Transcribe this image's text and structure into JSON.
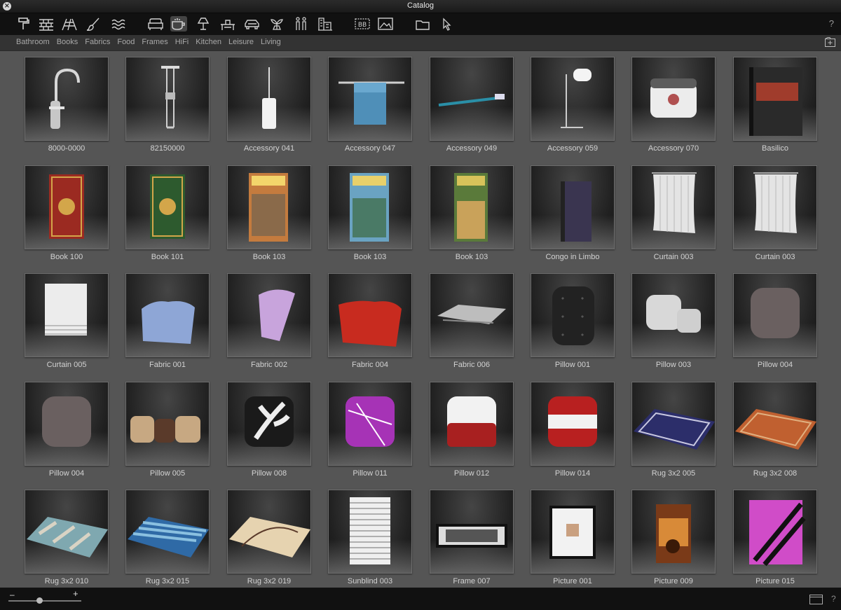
{
  "window": {
    "title": "Catalog",
    "close_glyph": "×"
  },
  "toolbar": {
    "icons": [
      "paint-roller-icon",
      "brick-wall-icon",
      "stairs-icon",
      "brush-icon",
      "water-waves-icon",
      "sofa-icon",
      "cup-icon",
      "lamp-icon",
      "desk-icon",
      "car-icon",
      "plant-icon",
      "people-icon",
      "building-icon",
      "billboard-icon",
      "picture-icon",
      "folder-icon",
      "cursor-icon"
    ],
    "active": "cup-icon",
    "help": "?"
  },
  "categories": [
    "Bathroom",
    "Books",
    "Fabrics",
    "Food",
    "Frames",
    "HiFi",
    "Kitchen",
    "Leisure",
    "Living"
  ],
  "items": [
    {
      "label": "8000-0000",
      "obj": "faucet"
    },
    {
      "label": "82150000",
      "obj": "shower"
    },
    {
      "label": "Accessory 041",
      "obj": "brush"
    },
    {
      "label": "Accessory 047",
      "obj": "towel"
    },
    {
      "label": "Accessory 049",
      "obj": "toothbrush"
    },
    {
      "label": "Accessory 059",
      "obj": "tp-stand"
    },
    {
      "label": "Accessory 070",
      "obj": "jar"
    },
    {
      "label": "Basilico",
      "obj": "book-dark"
    },
    {
      "label": "Book 100",
      "obj": "book-red"
    },
    {
      "label": "Book 101",
      "obj": "book-green"
    },
    {
      "label": "Book 103",
      "obj": "book-photo1"
    },
    {
      "label": "Book 103",
      "obj": "book-photo2"
    },
    {
      "label": "Book 103",
      "obj": "book-photo3"
    },
    {
      "label": "Congo in Limbo",
      "obj": "book-congo"
    },
    {
      "label": "Curtain 003",
      "obj": "curtain"
    },
    {
      "label": "Curtain 003",
      "obj": "curtain"
    },
    {
      "label": "Curtain 005",
      "obj": "curtain-roman"
    },
    {
      "label": "Fabric 001",
      "obj": "fabric-blue"
    },
    {
      "label": "Fabric 002",
      "obj": "fabric-purple"
    },
    {
      "label": "Fabric 004",
      "obj": "fabric-red"
    },
    {
      "label": "Fabric 006",
      "obj": "fabric-folded"
    },
    {
      "label": "Pillow 001",
      "obj": "pillow-leather"
    },
    {
      "label": "Pillow 003",
      "obj": "pillow-white"
    },
    {
      "label": "Pillow 004",
      "obj": "pillow-brown"
    },
    {
      "label": "Pillow 004",
      "obj": "pillow-brown"
    },
    {
      "label": "Pillow 005",
      "obj": "pillow-set"
    },
    {
      "label": "Pillow 008",
      "obj": "pillow-floral"
    },
    {
      "label": "Pillow 011",
      "obj": "pillow-magenta"
    },
    {
      "label": "Pillow 012",
      "obj": "pillow-redwhite"
    },
    {
      "label": "Pillow 014",
      "obj": "pillow-stripe"
    },
    {
      "label": "Rug 3x2 005",
      "obj": "rug-blue"
    },
    {
      "label": "Rug 3x2 008",
      "obj": "rug-orange"
    },
    {
      "label": "Rug 3x2 010",
      "obj": "rug-patch"
    },
    {
      "label": "Rug 3x2 015",
      "obj": "rug-stripe"
    },
    {
      "label": "Rug 3x2 019",
      "obj": "rug-cream"
    },
    {
      "label": "Sunblind 003",
      "obj": "sunblind"
    },
    {
      "label": "Frame 007",
      "obj": "frame"
    },
    {
      "label": "Picture 001",
      "obj": "picture-white"
    },
    {
      "label": "Picture 009",
      "obj": "picture-coffee"
    },
    {
      "label": "Picture 015",
      "obj": "picture-pink"
    }
  ],
  "bottombar": {
    "zoom_minus": "–",
    "zoom_plus": "+",
    "zoom_level": 0.42,
    "help": "?"
  }
}
